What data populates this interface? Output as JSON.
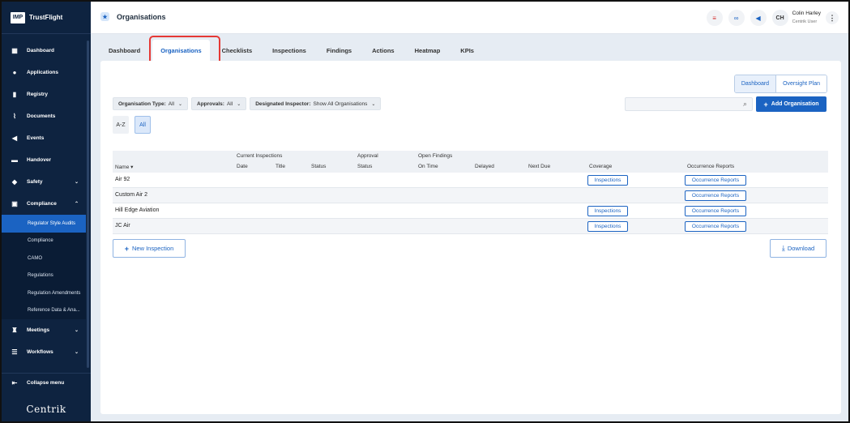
{
  "brand": {
    "logo_text": "IMP",
    "name": "TrustFlight"
  },
  "sidebar": {
    "items": [
      {
        "label": "Dashboard",
        "icon": "dashboard-icon"
      },
      {
        "label": "Applications",
        "icon": "person-icon"
      },
      {
        "label": "Registry",
        "icon": "book-icon"
      },
      {
        "label": "Documents",
        "icon": "paperclip-icon"
      },
      {
        "label": "Events",
        "icon": "megaphone-icon"
      },
      {
        "label": "Handover",
        "icon": "handover-icon"
      },
      {
        "label": "Safety",
        "icon": "shield-icon"
      },
      {
        "label": "Compliance",
        "icon": "compliance-icon"
      }
    ],
    "compliance_sub": [
      {
        "label": "Regulator Style Audits"
      },
      {
        "label": "Compliance"
      },
      {
        "label": "CAMO"
      },
      {
        "label": "Regulations"
      },
      {
        "label": "Regulation Amendments"
      },
      {
        "label": "Reference Data & Ana..."
      }
    ],
    "lower_items": [
      {
        "label": "Meetings",
        "icon": "meetings-icon"
      },
      {
        "label": "Workflows",
        "icon": "workflows-icon"
      }
    ],
    "collapse_label": "Collapse menu",
    "footer_logo": "Centrik"
  },
  "header": {
    "title": "Organisations",
    "user_initials": "CH",
    "user_name": "Colin Harley",
    "user_role": "Centrik User"
  },
  "tabs": [
    {
      "label": "Dashboard"
    },
    {
      "label": "Organisations"
    },
    {
      "label": "Checklists"
    },
    {
      "label": "Inspections"
    },
    {
      "label": "Findings"
    },
    {
      "label": "Actions"
    },
    {
      "label": "Heatmap"
    },
    {
      "label": "KPIs"
    }
  ],
  "view_toggle": {
    "dashboard": "Dashboard",
    "oversight": "Oversight Plan"
  },
  "filters": {
    "org_type_label": "Organisation Type:",
    "org_type_value": "All",
    "approvals_label": "Approvals:",
    "approvals_value": "All",
    "inspector_label": "Designated Inspector:",
    "inspector_value": "Show All Organisations"
  },
  "search": {
    "placeholder": ""
  },
  "add_button": "Add Organisation",
  "alpha": {
    "az": "A-Z",
    "all": "All"
  },
  "table": {
    "group_headers": {
      "current_inspections": "Current Inspections",
      "approval": "Approval",
      "open_findings": "Open Findings"
    },
    "columns": {
      "name": "Name ▾",
      "date": "Date",
      "title": "Title",
      "status": "Status",
      "approval_status": "Status",
      "on_time": "On Time",
      "delayed": "Delayed",
      "next_due": "Next Due",
      "coverage": "Coverage",
      "occurrence": "Occurrence Reports"
    },
    "rows": [
      {
        "name": "Air 92",
        "coverage": "Inspections",
        "occurrence": "Occurrence Reports"
      },
      {
        "name": "Custom Air 2",
        "coverage": "",
        "occurrence": "Occurrence Reports"
      },
      {
        "name": "Hill Edge Aviation",
        "coverage": "Inspections",
        "occurrence": "Occurrence Reports"
      },
      {
        "name": "JC Air",
        "coverage": "Inspections",
        "occurrence": "Occurrence Reports"
      }
    ]
  },
  "new_inspection": "New Inspection",
  "download": "Download",
  "colors": {
    "primary": "#1b63c2",
    "sidebar": "#0e2340",
    "highlight": "#e53935"
  }
}
